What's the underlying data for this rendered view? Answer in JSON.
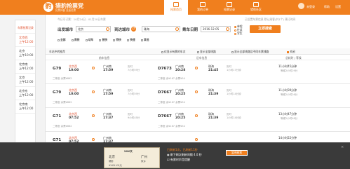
{
  "header": {
    "brand": "猎豹抢票党",
    "brand_sub": "抢票神器 高速抢票",
    "nav": [
      "抢票首页",
      "我的订单",
      "抢票记录",
      "猎豹社区"
    ],
    "account": "未登录",
    "help": "帮助",
    "menu": "设置"
  },
  "sidebar": {
    "title": "车票抢票记录",
    "items": [
      "北京西\n上午12:00",
      "北京\n上午10:00",
      "北京南\n上午12:00",
      "北京\n上午12:00",
      "北京东\n上午12:00",
      "北京南\n上午12:00"
    ]
  },
  "search": {
    "hint": "今日可订票：10月24日 - 01月20日车票",
    "hint2": "已设置车票信息  默认乘客(共1个)  预订时间",
    "from_label": "出发城市",
    "from_value": "北京",
    "to_label": "到达城市",
    "to_value": "珠海",
    "date_label": "乘车日期",
    "date_value": "2016-12-05",
    "radios": [
      "单程",
      "往返",
      "学生"
    ],
    "search_button": "立即搜索",
    "filters": [
      "全部",
      "高铁",
      "动车",
      "普快",
      "特快",
      "快速",
      "其他"
    ]
  },
  "list": {
    "head_left": "车站中转推荐",
    "head_opts": [
      "仅显示有票的车次",
      "显示全部线路",
      "显示全部线路及不同车票线路"
    ],
    "head_right": "关闭",
    "cols": [
      "前车信息",
      "后车信息",
      "总耗时 / 等候"
    ],
    "rows": [
      {
        "t1": "G79",
        "s1": "北京西",
        "d1": "10:00",
        "a1": "广州南",
        "ta1": "17:59",
        "mid": "历时\n7小时59分",
        "t2": "D7673",
        "s2": "广州南",
        "d2": "20:28",
        "a2": "珠海",
        "ta2": "21:45",
        "mid2": "历时\n1小时17分钟",
        "tot": "11小时45分钟",
        "wait": "等候2小时29分",
        "seat": "二等座 余票¥862",
        "seat2": "二等座 余¥167 余票¥54"
      },
      {
        "t1": "G79",
        "s1": "北京西",
        "d1": "10:00",
        "a1": "广州南",
        "ta1": "17:59",
        "mid": "历时\n7小时59分",
        "t2": "D7667",
        "s2": "广州南",
        "d2": "20:25",
        "a2": "珠海",
        "ta2": "21:39",
        "mid2": "历时\n1小时14分钟",
        "tot": "11小时39分钟",
        "wait": "等候2小时26分",
        "seat": "二等座 余票¥862",
        "seat2": "二等座 余¥167 余票¥54"
      },
      {
        "t1": "G71",
        "s1": "北京西",
        "d1": "07:52",
        "a1": "广州南",
        "ta1": "17:37",
        "mid": "历时\n9小时45分",
        "t2": "D7667",
        "s2": "广州南",
        "d2": "20:25",
        "a2": "珠海",
        "ta2": "21:39",
        "mid2": "历时\n1小时14分钟",
        "tot": "13小时47分钟",
        "wait": "等候2小时48分",
        "seat": "二等座 余票¥862",
        "seat2": "二等座 余¥167 余票¥54"
      },
      {
        "t1": "G71",
        "s1": "北京西",
        "d1": "07:52",
        "a1": "广州南",
        "ta1": "17:37",
        "mid": "",
        "t2": "",
        "s2": "",
        "d2": "",
        "a2": "",
        "ta2": "",
        "mid2": "",
        "tot": "14小时22分钟",
        "wait": "",
        "seat": "",
        "seat2": ""
      }
    ]
  },
  "bottom": {
    "ticket_title": "XXX次",
    "ticket_from": "北京",
    "ticket_to": "广州",
    "ticket_seat": "硬卧",
    "ticket_name": "家乡",
    "ticket_price": "¥XXX.XX元",
    "text1": "已刷新1次，已刷新11秒",
    "text2": "◉ 刷下刷次刷新间隔 4.0 秒",
    "text3": "☑ 有票时声音提醒",
    "stop": "暂停刷票",
    "close": "×"
  }
}
